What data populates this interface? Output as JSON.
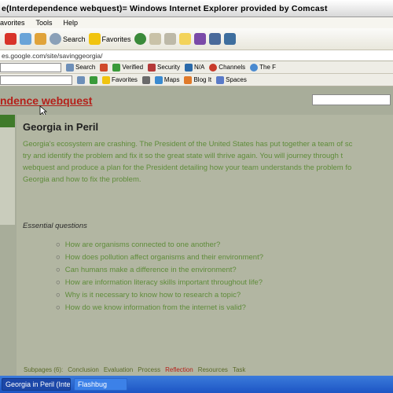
{
  "window": {
    "title": "e(Interdependence webquest)=   Windows Internet Explorer provided by Comcast"
  },
  "menu": {
    "items": [
      "avorites",
      "Tools",
      "Help"
    ]
  },
  "toolbar": {
    "search_label": "Search",
    "favorites_label": "Favorites"
  },
  "address": {
    "url": "es.google.com/site/savinggeorgia/"
  },
  "toolbar2": {
    "search_label": "Search",
    "verified_label": "Verified",
    "security_label": "Security",
    "na_label": "N/A",
    "channels_label": "Channels",
    "the_f_label": "The F"
  },
  "toolbar3": {
    "favorites_label": "Favorites",
    "maps_label": "Maps",
    "blogit_label": "Blog It",
    "spaces_label": "Spaces"
  },
  "site": {
    "title": "ndence webquest",
    "page_title": "Georgia in Peril",
    "intro_lines": [
      "Georgia's ecosystem are crashing.  The President of the United States has put together a team of sc",
      "try and identify the problem and fix it so the great state will thrive again. You will journey through t",
      "webquest and produce a plan for the President detailing how your team understands the problem fo",
      "Georgia and how to fix the problem."
    ],
    "essential_questions_heading": "Essential questions",
    "questions": [
      "How are organisms connected to one another?",
      "How does pollution affect organisms and their environment?",
      "Can humans make a difference in the environment?",
      "How are information literacy skills important throughout life?",
      "Why is it necessary to know how to research a topic?",
      "How do we know information from the internet is valid?"
    ],
    "bottom_nav": [
      "Subpages (6):",
      "Conclusion",
      "Evaluation",
      "Process",
      "Reflection",
      "Resources",
      "Task"
    ]
  },
  "taskbar": {
    "items": [
      "Georgia in Peril (Inter...",
      "Flashbug"
    ]
  },
  "colors": {
    "title_red": "#b4201a",
    "text_green": "#5f8c3a",
    "page_bg": "#a8ad9a",
    "taskbar_blue": "#1d55c4"
  }
}
